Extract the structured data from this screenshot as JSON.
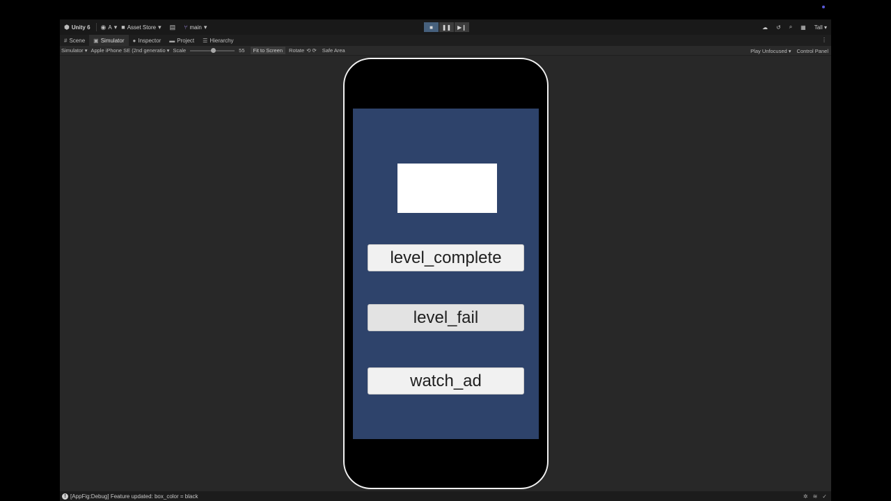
{
  "topbar": {
    "app_name": "Unity 6",
    "account": "A",
    "asset_store": "Asset Store",
    "branch": "main",
    "layout": "Tall"
  },
  "tabs": [
    {
      "label": "Scene",
      "icon": "grid-icon"
    },
    {
      "label": "Simulator",
      "icon": "simulator-icon"
    },
    {
      "label": "Inspector",
      "icon": "info-icon"
    },
    {
      "label": "Project",
      "icon": "folder-icon"
    },
    {
      "label": "Hierarchy",
      "icon": "list-icon"
    }
  ],
  "simbar": {
    "mode": "Simulator",
    "device": "Apple iPhone SE (2nd generatio",
    "scale_label": "Scale",
    "scale_value": "55",
    "fit_to_screen": "Fit to Screen",
    "rotate": "Rotate",
    "safe_area": "Safe Area",
    "play_mode": "Play Unfocused",
    "control_panel": "Control Panel"
  },
  "game": {
    "buttons": [
      "level_complete",
      "level_fail",
      "watch_ad"
    ]
  },
  "status": {
    "message": "[AppFig:Debug] Feature updated: box_color = black"
  },
  "colors": {
    "editor_bg": "#282828",
    "screen_bg": "#2e436b",
    "play_active": "#46607c"
  }
}
